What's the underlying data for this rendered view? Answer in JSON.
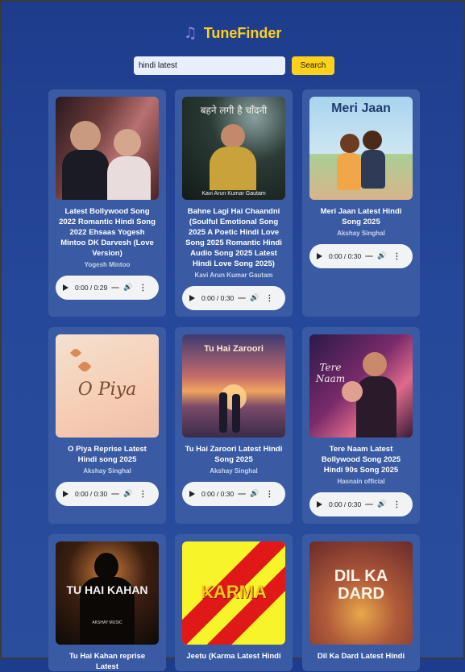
{
  "app": {
    "title": "TuneFinder",
    "icon": "music-notes-icon",
    "accent": "#ffd11a"
  },
  "search": {
    "value": "hindi latest",
    "button": "Search"
  },
  "cards": [
    {
      "title": "Latest Bollywood Song 2022 Romantic Hindi Song 2022 Ehsaas Yogesh Mintoo DK Darvesh (Love Version)",
      "artist": "Yogesh Mintoo",
      "time": "0:00 / 0:29",
      "thumb_text": ""
    },
    {
      "title": "Bahne Lagi Hai Chaandni (Soulful Emotional Song 2025 A Poetic Hindi Love Song 2025 Romantic Hindi Audio Song 2025 Latest Hindi Love Song 2025)",
      "artist": "Kavi Arun Kumar Gautam",
      "time": "0:00 / 0:30",
      "thumb_text": "बहने लगी है चाँदनी",
      "thumb_sub": "Kavi Arun Kumar Gautam"
    },
    {
      "title": "Meri Jaan Latest Hindi Song 2025",
      "artist": "Akshay Singhal",
      "time": "0:00 / 0:30",
      "thumb_text": "Meri Jaan"
    },
    {
      "title": "O Piya Reprise Latest Hindi song 2025",
      "artist": "Akshay Singhal",
      "time": "0:00 / 0:30",
      "thumb_text": "O Piya"
    },
    {
      "title": "Tu Hai Zaroori Latest Hindi Song 2025",
      "artist": "Akshay Singhal",
      "time": "0:00 / 0:30",
      "thumb_text": "Tu Hai Zaroori"
    },
    {
      "title": "Tere Naam Latest Bollywood Song 2025 Hindi 90s Song 2025",
      "artist": "Hasnain official",
      "time": "0:00 / 0:30",
      "thumb_text": "Tere Naam"
    },
    {
      "title": "Tu Hai Kahan reprise Latest",
      "artist": "",
      "time": "",
      "thumb_text": "TU HAI KAHAN",
      "thumb_sub": "AKSHAY MUSIC"
    },
    {
      "title": "Jeetu (Karma Latest Hindi",
      "artist": "",
      "time": "",
      "thumb_text": "KARMA"
    },
    {
      "title": "Dil Ka Dard Latest Hindi",
      "artist": "",
      "time": "",
      "thumb_text": "DIL KA DARD"
    }
  ]
}
